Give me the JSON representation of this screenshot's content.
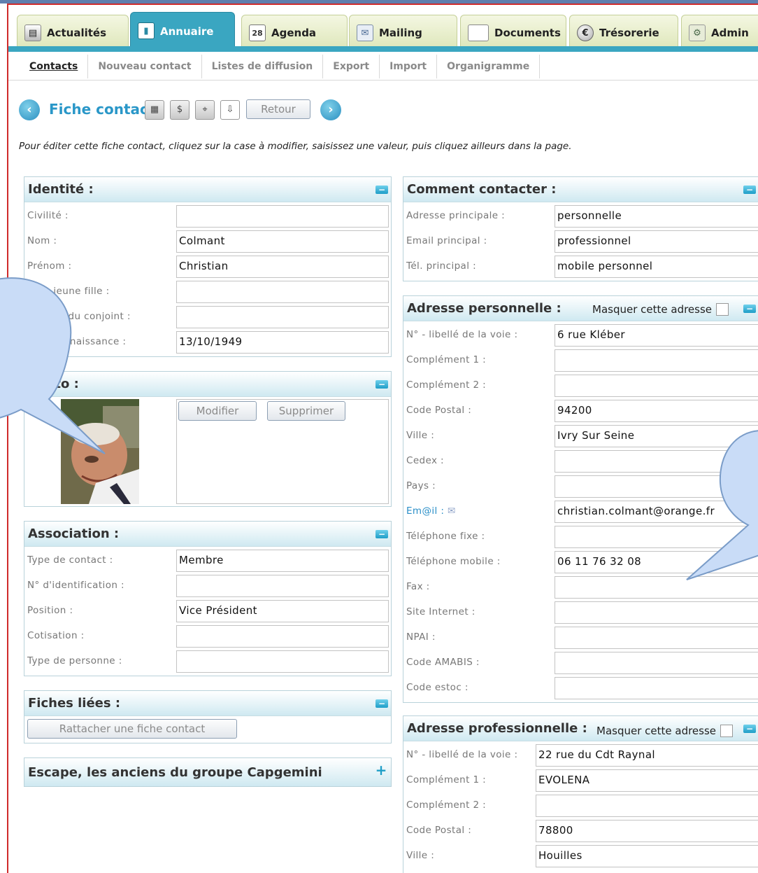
{
  "tabs": [
    {
      "label": "Actualités",
      "icon": "newspaper-icon",
      "active": false
    },
    {
      "label": "Annuaire",
      "icon": "book-icon",
      "active": true
    },
    {
      "label": "Agenda",
      "icon": "calendar-icon",
      "active": false
    },
    {
      "label": "Mailing",
      "icon": "mail-icon",
      "active": false
    },
    {
      "label": "Documents",
      "icon": "folder-icon",
      "active": false
    },
    {
      "label": "Trésorerie",
      "icon": "euro-icon",
      "active": false
    },
    {
      "label": "Admin",
      "icon": "admin-icon",
      "active": false
    }
  ],
  "calendar_day": "28",
  "subnav": [
    {
      "label": "Contacts",
      "active": true
    },
    {
      "label": "Nouveau contact",
      "active": false
    },
    {
      "label": "Listes de diffusion",
      "active": false
    },
    {
      "label": "Export",
      "active": false
    },
    {
      "label": "Import",
      "active": false
    },
    {
      "label": "Organigramme",
      "active": false
    }
  ],
  "fiche": {
    "title": "Fiche contact",
    "back_label": "Retour",
    "prev_glyph": "‹",
    "next_glyph": "›",
    "instructions": "Pour éditer cette fiche contact, cliquez sur la case à modifier, saisissez une valeur, puis cliquez ailleurs dans la page."
  },
  "identite": {
    "title": "Identité :",
    "toggle": "−",
    "fields": [
      {
        "label": "Civilité :",
        "value": ""
      },
      {
        "label": "Nom :",
        "value": "Colmant"
      },
      {
        "label": "Prénom :",
        "value": "Christian"
      },
      {
        "label": "Nom jeune fille :",
        "value": ""
      },
      {
        "label": "Prénom du conjoint :",
        "value": ""
      },
      {
        "label": "Date de naissance :",
        "value": "13/10/1949"
      }
    ]
  },
  "photo": {
    "title": "Photo :",
    "toggle": "−",
    "modify_label": "Modifier",
    "delete_label": "Supprimer"
  },
  "association": {
    "title": "Association :",
    "toggle": "−",
    "fields": [
      {
        "label": "Type de contact :",
        "value": "Membre"
      },
      {
        "label": "N° d'identification :",
        "value": ""
      },
      {
        "label": "Position :",
        "value": "Vice Président"
      },
      {
        "label": "Cotisation :",
        "value": ""
      },
      {
        "label": "Type de personne :",
        "value": ""
      }
    ]
  },
  "fiches_liees": {
    "title": "Fiches liées :",
    "toggle": "−",
    "attach_label": "Rattacher une fiche contact"
  },
  "escape": {
    "title": "Escape, les anciens du groupe Capgemini",
    "toggle": "+"
  },
  "comment_contacter": {
    "title": "Comment contacter :",
    "toggle": "−",
    "fields": [
      {
        "label": "Adresse principale :",
        "value": "personnelle"
      },
      {
        "label": "Email principal :",
        "value": "professionnel"
      },
      {
        "label": "Tél. principal :",
        "value": "mobile personnel"
      }
    ]
  },
  "adresse_perso": {
    "title": "Adresse personnelle :",
    "mask_label": "Masquer cette adresse",
    "toggle": "−",
    "email_label": "Em@il :",
    "email_value": "christian.colmant@orange.fr",
    "fields": [
      {
        "label": "N° - libellé de la voie :",
        "value": "6 rue Kléber"
      },
      {
        "label": "Complément 1 :",
        "value": ""
      },
      {
        "label": "Complément 2 :",
        "value": ""
      },
      {
        "label": "Code Postal :",
        "value": "94200"
      },
      {
        "label": "Ville :",
        "value": "Ivry Sur Seine"
      },
      {
        "label": "Cedex :",
        "value": ""
      },
      {
        "label": "Pays :",
        "value": ""
      },
      {
        "label": "Téléphone fixe :",
        "value": ""
      },
      {
        "label": "Téléphone mobile :",
        "value": "06 11 76 32 08"
      },
      {
        "label": "Fax :",
        "value": ""
      },
      {
        "label": "Site Internet :",
        "value": ""
      },
      {
        "label": "NPAI :",
        "value": ""
      },
      {
        "label": "Code AMABIS :",
        "value": ""
      },
      {
        "label": "Code estoc :",
        "value": ""
      }
    ]
  },
  "adresse_pro": {
    "title": "Adresse professionnelle :",
    "mask_label": "Masquer cette adresse",
    "toggle": "−",
    "fields": [
      {
        "label": "N° - libellé de la voie :",
        "value": "22 rue du Cdt Raynal"
      },
      {
        "label": "Complément 1 :",
        "value": "EVOLENA"
      },
      {
        "label": "Complément 2 :",
        "value": ""
      },
      {
        "label": "Code Postal :",
        "value": "78800"
      },
      {
        "label": "Ville :",
        "value": "Houilles"
      }
    ]
  },
  "colors": {
    "accent": "#3aa6c1",
    "frame_red": "#d02b2b",
    "title_blue": "#2a97c8",
    "callout_fill": "#c9dcf7",
    "callout_stroke": "#7a9cc8"
  }
}
